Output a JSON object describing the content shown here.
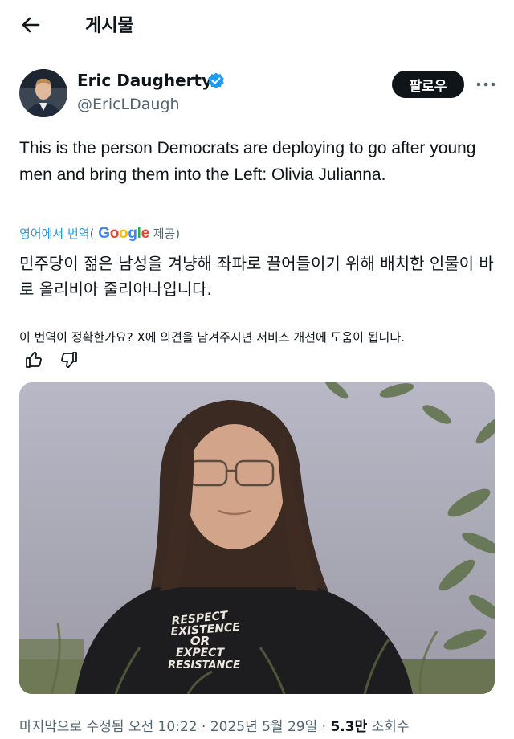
{
  "header": {
    "title": "게시물",
    "back_icon": "arrow-left-icon"
  },
  "author": {
    "name": "Eric Daugherty",
    "handle": "@EricLDaugh",
    "verified_color": "#1d9bf0",
    "follow_label": "팔로우",
    "more_icon": "more-horizontal-icon"
  },
  "tweet": {
    "text": "This is the person Democrats are deploying to go after young men and bring them into the Left: Olivia Julianna."
  },
  "translation": {
    "link_label": "영어에서 번역",
    "paren_open": "(",
    "provider": "Google",
    "provided_by": "제공)",
    "text": "민주당이 젊은 남성을 겨냥해 좌파로 끌어들이기 위해 배치한 인물이 바로 올리비아 줄리아나입니다."
  },
  "feedback": {
    "question": "이 번역이 정확한가요? X에 의견을 남겨주시면 서비스 개선에 도움이 됩니다.",
    "up_icon": "thumbs-up-icon",
    "down_icon": "thumbs-down-icon"
  },
  "media": {
    "shirt_lines": [
      "RESPECT",
      "EXISTENCE",
      "OR",
      "EXPECT",
      "RESISTANCE"
    ]
  },
  "meta": {
    "edited": "마지막으로 수정됨 오전 10:22 · 2025년 5월 29일 · ",
    "views": "5.3만",
    "views_label": " 조회수"
  },
  "colors": {
    "accent": "#1d9bf0",
    "text": "#0f1419",
    "muted": "#536471"
  }
}
